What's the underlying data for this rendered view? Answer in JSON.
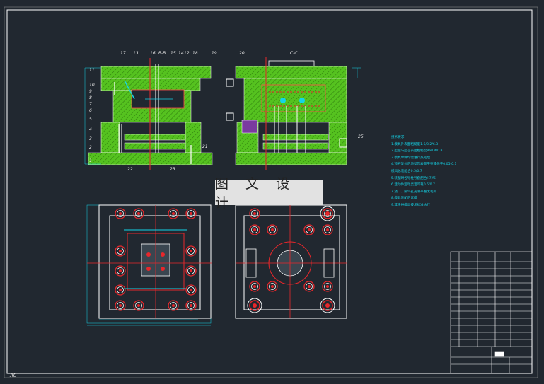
{
  "stamp": {
    "text": "图 文 设 计"
  },
  "section_labels": {
    "b_b": "B-B",
    "c_c": "C-C"
  },
  "part_numbers_left": [
    "11",
    "10",
    "9",
    "8",
    "7",
    "6",
    "5",
    "4",
    "3",
    "2",
    "1"
  ],
  "part_numbers_top": [
    "17",
    "13",
    "16",
    "15",
    "14",
    "12",
    "18",
    "19",
    "20"
  ],
  "part_numbers_right": [
    "25",
    "21",
    "22",
    "23"
  ],
  "notes": {
    "title": "技术要求",
    "lines": [
      "1.模具外表面粗糙度1.6/3.2/6.3",
      "2.型腔与型芯表面粗糙度Ra0.4/0.8",
      "3.模具零件均需进行热处理",
      "4.顶杆复位后与型芯表面平齐或低于0.05-0.1",
      "  模具总装配合0.5/0.7",
      "5.装配时各导柱导套配合H7/f6",
      "6.活动件运动灵活可靠0.5/0.7",
      "7.浇口、排气孔光滑平整无毛刺",
      "8.模具装配后试模",
      "9.其余按模具技术标准执行"
    ]
  },
  "corner_label": "A0",
  "colors": {
    "background": "#212830",
    "mold_green": "#55c21f",
    "cyan": "#14d4e8",
    "red": "#e8272b"
  }
}
